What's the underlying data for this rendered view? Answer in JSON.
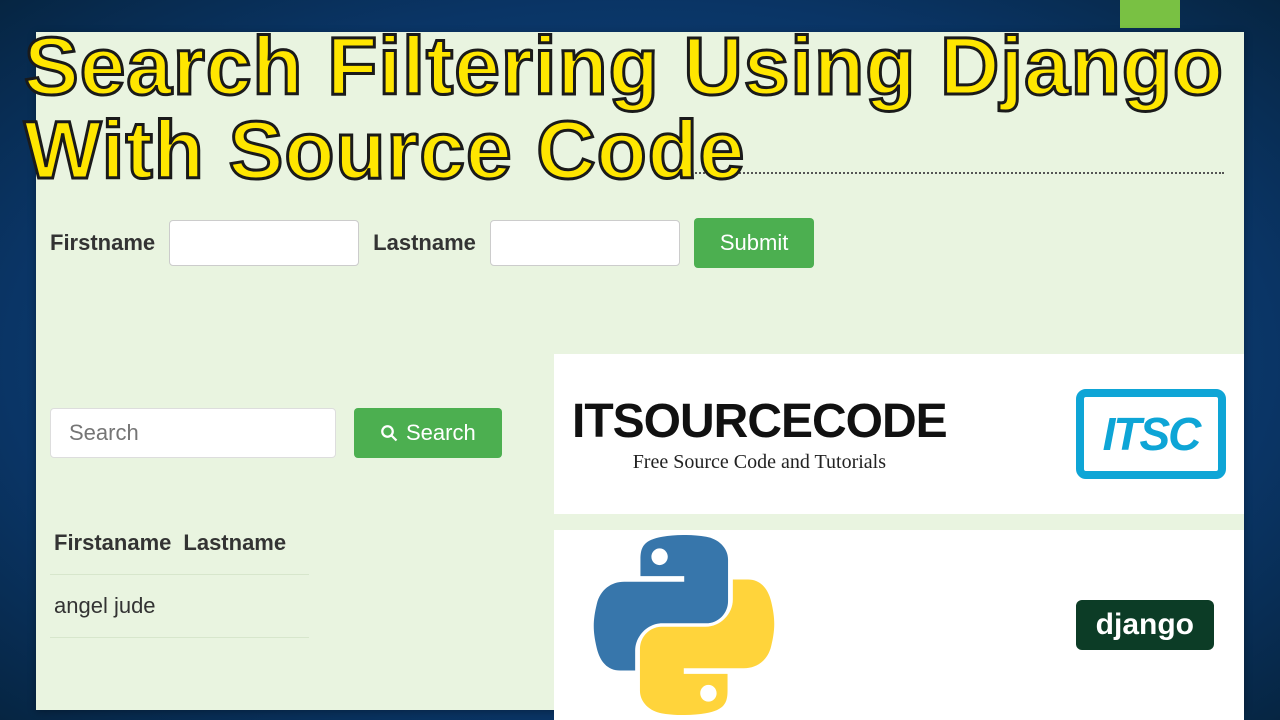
{
  "headline": {
    "line1": "Search Filtering Using Django",
    "line2": "With Source Code"
  },
  "form": {
    "firstname_label": "Firstname",
    "lastname_label": "Lastname",
    "submit_label": "Submit"
  },
  "search": {
    "placeholder": "Search",
    "button_label": "Search"
  },
  "table": {
    "headers": {
      "firstname": "Firstaname",
      "lastname": "Lastname"
    },
    "rows": [
      {
        "firstname": "angel jude",
        "lastname": ""
      }
    ]
  },
  "promo": {
    "title": "ITSOURCECODE",
    "subtitle": "Free Source Code and Tutorials",
    "badge": "ITSC"
  },
  "promo2": {
    "django_label": "django"
  }
}
